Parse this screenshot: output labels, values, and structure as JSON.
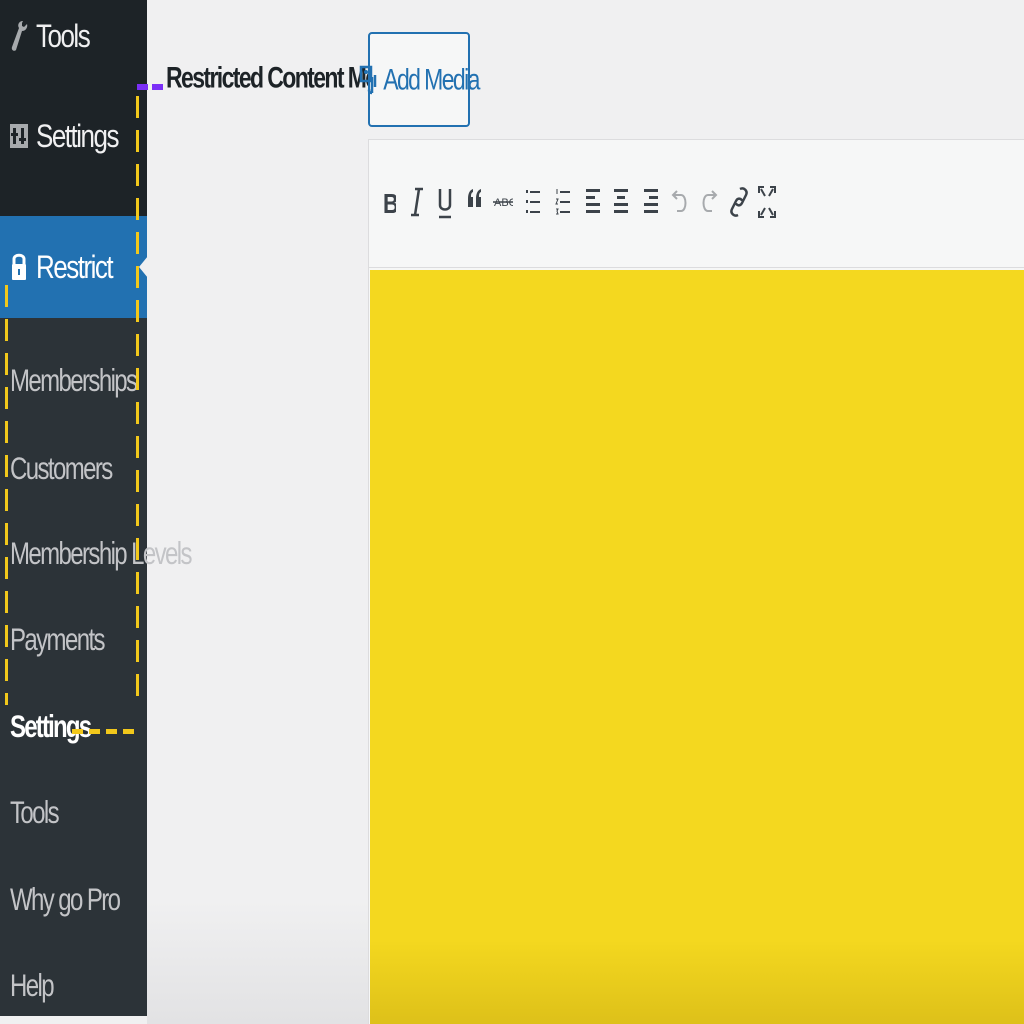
{
  "sidebar": {
    "top_items": [
      {
        "label": "Tools",
        "icon": "wrench-icon"
      },
      {
        "label": "Settings",
        "icon": "settings-sliders-icon"
      }
    ],
    "active_item": {
      "label": "Restrict",
      "icon": "lock-icon"
    },
    "submenu": [
      {
        "label": "Memberships"
      },
      {
        "label": "Customers"
      },
      {
        "label": "Membership Levels"
      },
      {
        "label": "Payments"
      },
      {
        "label": "Settings",
        "current": true
      },
      {
        "label": "Tools"
      },
      {
        "label": "Why go Pro"
      },
      {
        "label": "Help"
      }
    ]
  },
  "main": {
    "field_label": "Restricted Content Message",
    "add_media": {
      "label": "Add Media",
      "icon": "media-icon"
    },
    "toolbar": {
      "buttons": [
        {
          "name": "bold",
          "glyph": "B",
          "icon": "bold-icon"
        },
        {
          "name": "italic",
          "glyph": "I",
          "icon": "italic-icon"
        },
        {
          "name": "underline",
          "glyph": "U",
          "icon": "underline-icon"
        },
        {
          "name": "blockquote",
          "glyph": "66",
          "icon": "blockquote-icon"
        },
        {
          "name": "strikethrough",
          "glyph": "ABC",
          "icon": "strikethrough-icon"
        },
        {
          "name": "bullet-list",
          "icon": "bullet-list-icon"
        },
        {
          "name": "numbered-list",
          "icon": "numbered-list-icon"
        },
        {
          "name": "align-left",
          "icon": "align-left-icon"
        },
        {
          "name": "align-center",
          "icon": "align-center-icon"
        },
        {
          "name": "align-right",
          "icon": "align-right-icon"
        },
        {
          "name": "undo",
          "icon": "undo-icon"
        },
        {
          "name": "redo",
          "icon": "redo-icon"
        },
        {
          "name": "link",
          "icon": "link-icon"
        },
        {
          "name": "fullscreen",
          "icon": "fullscreen-icon"
        }
      ]
    }
  },
  "colors": {
    "sidebar_bg": "#2c3338",
    "sidebar_top_bg": "#1d2327",
    "active_blue": "#2271b1",
    "highlight_yellow": "#f2c81b",
    "content_yellow": "#f4d81f",
    "marker_purple": "#7b2ff7"
  }
}
